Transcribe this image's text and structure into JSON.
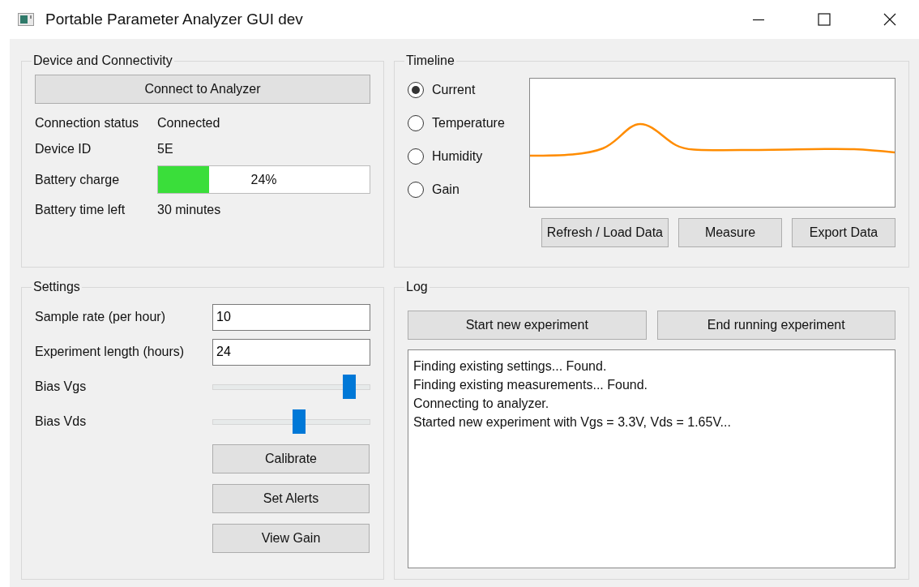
{
  "window": {
    "title": "Portable Parameter Analyzer GUI dev"
  },
  "device": {
    "title": "Device and Connectivity",
    "connect_button": "Connect to Analyzer",
    "fields": [
      {
        "kind": "text",
        "label": "Connection status",
        "value": "Connected"
      },
      {
        "kind": "text",
        "label": "Device ID",
        "value": "5E"
      },
      {
        "kind": "progress",
        "label": "Battery charge",
        "level": 0.24,
        "reading": "24%"
      },
      {
        "kind": "text",
        "label": "Battery time left",
        "value": "30 minutes"
      }
    ]
  },
  "timeline": {
    "title": "Timeline",
    "options": [
      {
        "label": "Current",
        "selected": true
      },
      {
        "label": "Temperature",
        "selected": false
      },
      {
        "label": "Humidity",
        "selected": false
      },
      {
        "label": "Gain",
        "selected": false
      }
    ],
    "buttons": [
      "Refresh / Load Data",
      "Measure",
      "Export Data"
    ]
  },
  "settings": {
    "title": "Settings",
    "fields": [
      {
        "kind": "input",
        "label": "Sample rate (per hour)",
        "value": "10"
      },
      {
        "kind": "input",
        "label": "Experiment length (hours)",
        "value": "24"
      },
      {
        "kind": "slider",
        "label": "Bias Vgs",
        "level": 0.9
      },
      {
        "kind": "slider",
        "label": "Bias Vds",
        "level": 0.55
      }
    ],
    "buttons": [
      "Calibrate",
      "Set Alerts",
      "View Gain"
    ]
  },
  "log": {
    "title": "Log",
    "buttons": [
      "Start new experiment",
      "End running experiment"
    ],
    "lines": [
      "Finding existing settings... Found.",
      "Finding existing measurements... Found.",
      "Connecting to analyzer.",
      "Started new experiment with Vgs = 3.3V, Vds = 1.65V..."
    ]
  }
}
